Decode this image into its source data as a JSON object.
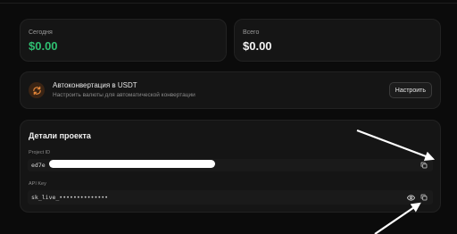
{
  "stats": {
    "today": {
      "label": "Сегодня",
      "value": "$0.00",
      "color": "#2fbf71"
    },
    "total": {
      "label": "Всего",
      "value": "$0.00",
      "color": "#f2f2f2"
    }
  },
  "autoconvert": {
    "icon": "refresh-icon",
    "icon_color": "#e8893a",
    "title": "Автоконвертация в USDT",
    "subtitle": "Настроить валюты для автоматической конвертации",
    "button_label": "Настроить"
  },
  "details": {
    "title": "Детали проекта",
    "project_id": {
      "label": "Project ID",
      "value": "ed7e",
      "copy_icon": "copy-icon"
    },
    "api_key": {
      "label": "API Key",
      "value": "sk_live_••••••••••••••",
      "eye_icon": "eye-icon",
      "copy_icon": "copy-icon"
    }
  },
  "annotations": {
    "arrow_color": "#ffffff"
  }
}
